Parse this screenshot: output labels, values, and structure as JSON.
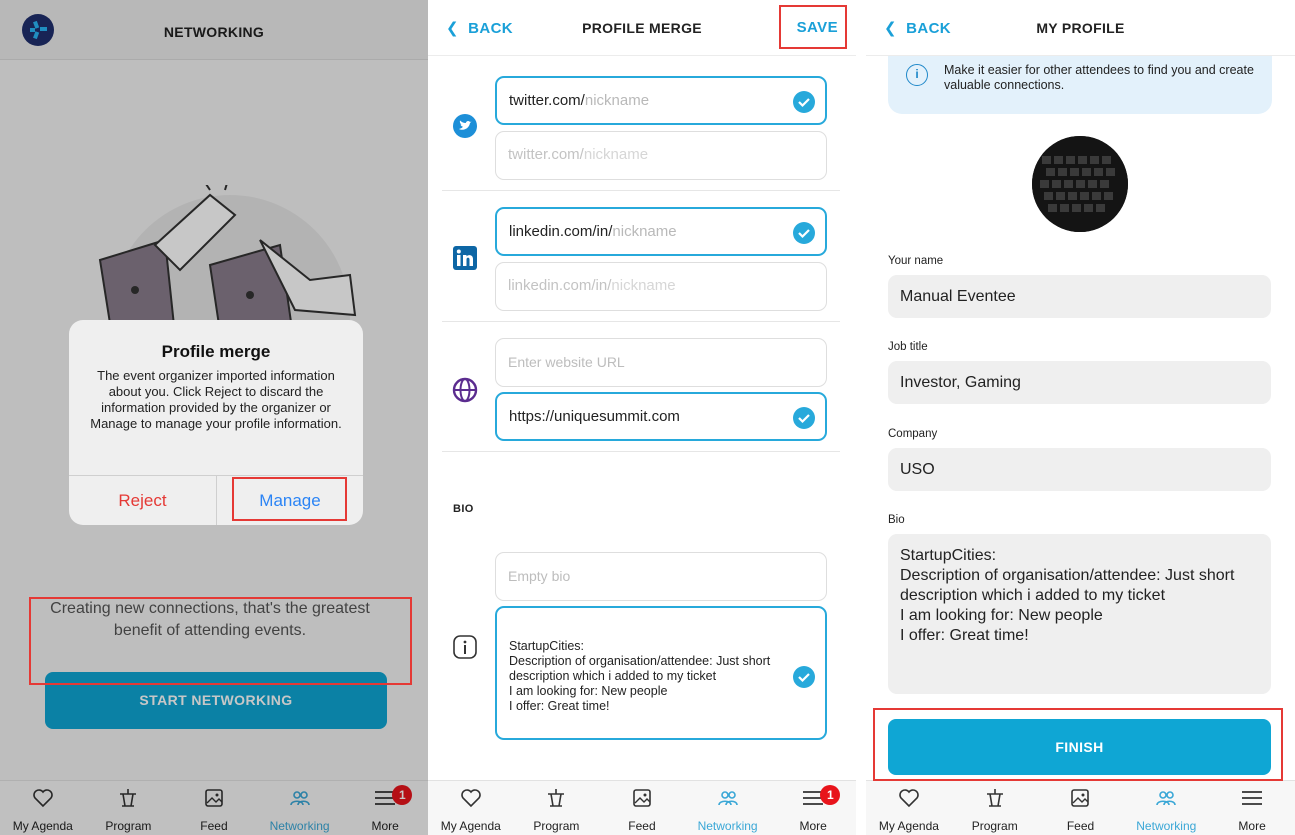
{
  "panel1": {
    "title": "NETWORKING",
    "subtitle": "Creating new connections, that's the greatest benefit of attending events.",
    "start_button": "START NETWORKING",
    "dialog": {
      "title": "Profile merge",
      "message": "The event organizer imported information about you. Click Reject to discard the information provided by the organizer or Manage to manage your profile information.",
      "reject": "Reject",
      "manage": "Manage"
    }
  },
  "panel2": {
    "back": "BACK",
    "title": "PROFILE MERGE",
    "save": "SAVE",
    "twitter_prefix": "twitter.com/",
    "twitter_placeholder": "nickname",
    "linkedin_prefix": "linkedin.com/in/",
    "linkedin_placeholder": "nickname",
    "website_placeholder": "Enter website URL",
    "website_value": "https://uniquesummit.com",
    "bio_label": "BIO",
    "bio_empty": "Empty bio",
    "bio_value": "StartupCities:\nDescription of organisation/attendee: Just short description which i added to my ticket\nI am looking for: New people\nI offer: Great time!"
  },
  "panel3": {
    "back": "BACK",
    "title": "MY PROFILE",
    "info": "Make it easier for other attendees to find you and create valuable connections.",
    "name_label": "Your name",
    "name_value": "Manual Eventee",
    "job_label": "Job title",
    "job_value": "Investor, Gaming",
    "company_label": "Company",
    "company_value": "USO",
    "bio_label": "Bio",
    "bio_value": "StartupCities:\nDescription of organisation/attendee: Just short description which i added to my ticket\nI am looking for: New people\nI offer: Great time!",
    "finish": "FINISH"
  },
  "tabs": {
    "agenda": "My Agenda",
    "program": "Program",
    "feed": "Feed",
    "networking": "Networking",
    "more": "More",
    "badge_count": "1"
  },
  "colors": {
    "accent": "#0fa6d4",
    "link": "#1aa0d8",
    "highlight": "#e53935",
    "reject": "#e53935",
    "manage": "#2b84f5"
  }
}
